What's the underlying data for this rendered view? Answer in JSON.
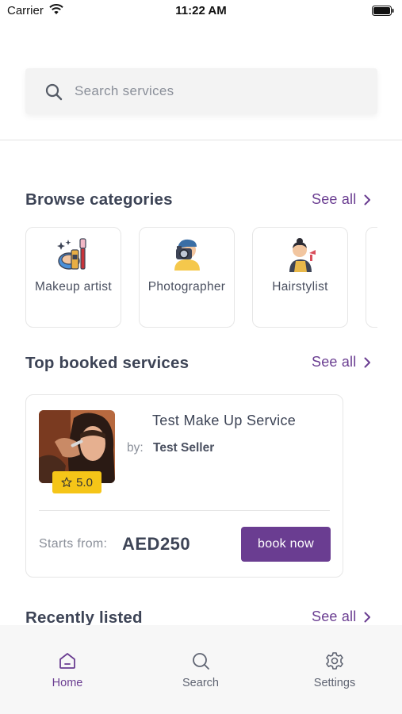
{
  "status_bar": {
    "carrier": "Carrier",
    "time": "11:22 AM"
  },
  "search": {
    "placeholder": "Search services",
    "value": ""
  },
  "categories_section": {
    "title": "Browse categories",
    "see_all": "See all",
    "items": [
      {
        "label": "Makeup artist",
        "icon": "makeup-icon"
      },
      {
        "label": "Photographer",
        "icon": "photographer-icon"
      },
      {
        "label": "Hairstylist",
        "icon": "hairstylist-icon"
      }
    ]
  },
  "top_booked": {
    "title": "Top booked services",
    "see_all": "See all",
    "service": {
      "title": "Test Make Up Service",
      "by_label": "by:",
      "seller": "Test Seller",
      "rating": "5.0",
      "starts_from_label": "Starts from:",
      "price": "AED250",
      "book_label": "book now"
    }
  },
  "recently_listed": {
    "title": "Recently listed",
    "see_all": "See all"
  },
  "tab_bar": {
    "items": [
      {
        "label": "Home",
        "icon": "home-icon",
        "active": true
      },
      {
        "label": "Search",
        "icon": "search-icon",
        "active": false
      },
      {
        "label": "Settings",
        "icon": "gear-icon",
        "active": false
      }
    ]
  },
  "colors": {
    "accent": "#6a3d91",
    "text": "#3d4456",
    "muted": "#8a8f99",
    "rating": "#f5c518"
  }
}
